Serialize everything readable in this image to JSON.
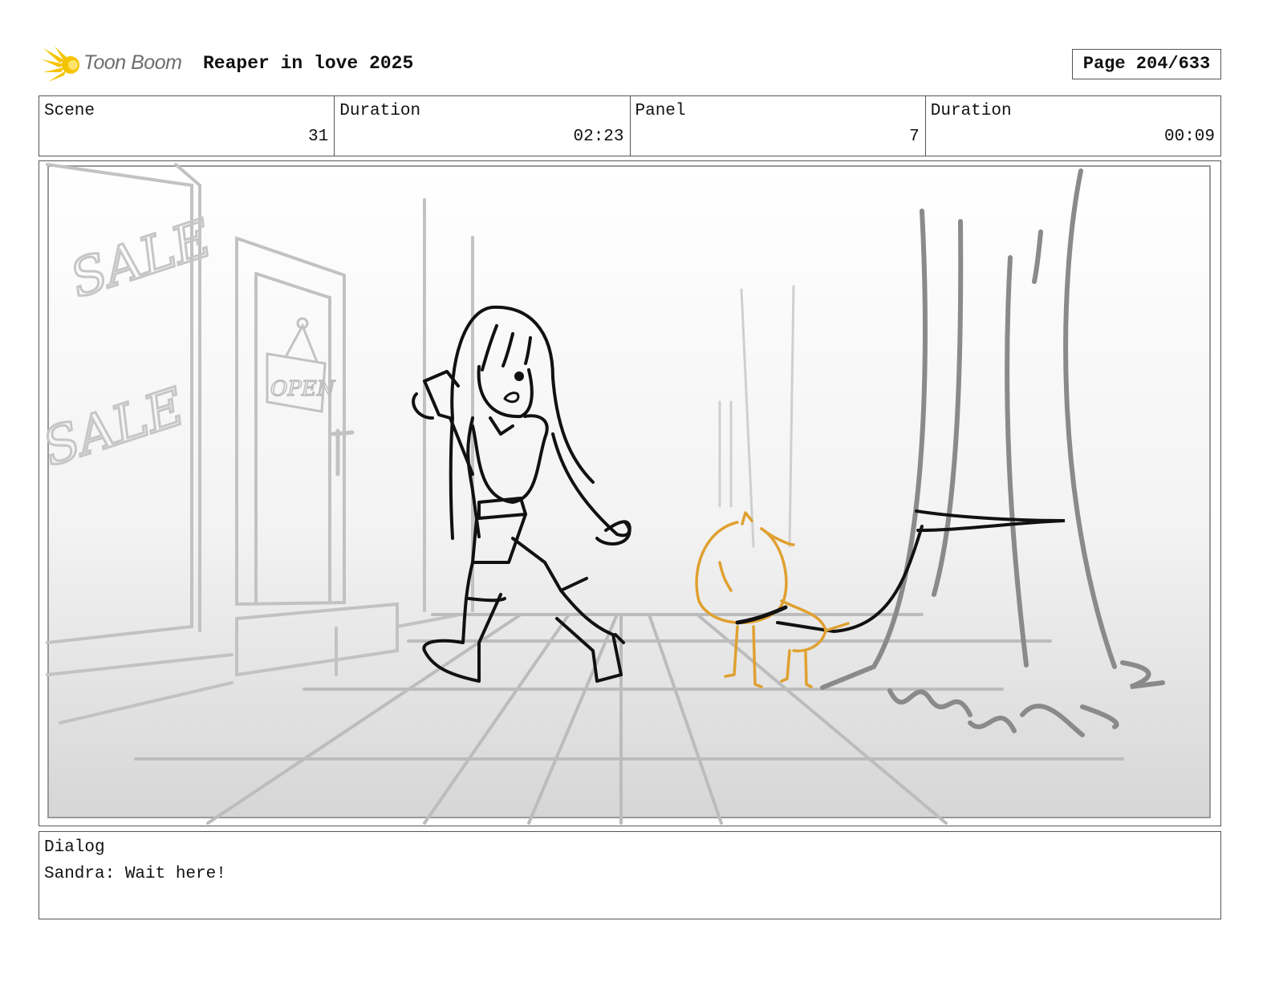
{
  "header": {
    "logo_text": "Toon Boom",
    "project_title": "Reaper in love 2025",
    "page_indicator": "Page 204/633",
    "brand_color": "#f5c400"
  },
  "info_row": [
    {
      "label": "Scene",
      "value": "31"
    },
    {
      "label": "Duration",
      "value": "02:23"
    },
    {
      "label": "Panel",
      "value": "7"
    },
    {
      "label": "Duration",
      "value": "00:09"
    }
  ],
  "panel": {
    "sketch_text_sale_1": "SALE",
    "sketch_text_sale_2": "SALE",
    "sketch_text_open": "OPEN",
    "dog_color": "#e0a030"
  },
  "dialog": {
    "label": "Dialog",
    "text": "Sandra: Wait here!"
  }
}
